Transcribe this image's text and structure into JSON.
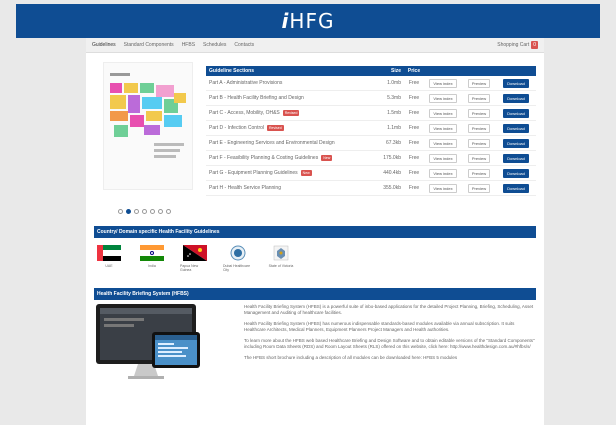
{
  "header": {
    "logo_prefix": "i",
    "logo_text": "HFG"
  },
  "nav": {
    "items": [
      "Guidelines",
      "Standard Components",
      "HFBS",
      "Schedules",
      "Contacts"
    ],
    "cart_label": "Shopping Cart",
    "cart_count": "0"
  },
  "guidelines": {
    "columns": [
      "Guideline Sections",
      "Size",
      "Price"
    ],
    "rows": [
      {
        "title": "Part A - Administrative Provisions",
        "size": "1.0mb",
        "price": "Free",
        "tag": ""
      },
      {
        "title": "Part B - Health Facility Briefing and Design",
        "size": "5.3mb",
        "price": "Free",
        "tag": ""
      },
      {
        "title": "Part C - Access, Mobility, OH&S",
        "size": "1.5mb",
        "price": "Free",
        "tag": "Revised"
      },
      {
        "title": "Part D - Infection Control",
        "size": "1.1mb",
        "price": "Free",
        "tag": "Revised"
      },
      {
        "title": "Part E - Engineering Services and Environmental Design",
        "size": "67.3kb",
        "price": "Free",
        "tag": ""
      },
      {
        "title": "Part F - Feasibility Planning & Costing Guidelines",
        "size": "175.0kb",
        "price": "Free",
        "tag": "New"
      },
      {
        "title": "Part G - Equipment Planning Guidelines",
        "size": "440.4kb",
        "price": "Free",
        "tag": "New"
      },
      {
        "title": "Part H - Health Service Planning",
        "size": "355.0kb",
        "price": "Free",
        "tag": ""
      }
    ],
    "view_index_label": "View index",
    "preview_label": "Preview",
    "download_label": "Download"
  },
  "country_section": {
    "title": "Country/ Domain specific Health Facility Guidelines",
    "flags": [
      {
        "label": "UAE",
        "icon": "uae-flag-icon"
      },
      {
        "label": "India",
        "icon": "india-flag-icon"
      },
      {
        "label": "Papua New Guinea",
        "icon": "png-flag-icon"
      },
      {
        "label": "Dubai Healthcare City",
        "icon": "dhcc-emblem-icon"
      },
      {
        "label": "State of Victoria",
        "icon": "victoria-emblem-icon"
      }
    ]
  },
  "hfbs_section": {
    "title": "Health Facility Briefing System (HFBS)",
    "paragraphs": [
      "Health Facility Briefing System (HFBS) is a powerful suite of inbo-based applications for the detailed Project Planning, Briefing, Scheduling, Asset Management and Auditing of healthcare facilities.",
      "Health Facility Briefing System (HFBS) has numerous indispensable standards-based modules available via annual subscription. It suits Healthcare Architects, Medical Planners, Equipment Planners Project Managers and Health authorities.",
      "To learn more about the HFBS web based Healthcare Briefing and Design Software and to obtain editable versions of the \"Standard Components\" including Room Data Sheets (RDS) and Room Layout Sheets (RLS) offered on this website, click here: http://www.healthdesign.com.au/#hfbs/s/",
      "The HFBS short brochure including a description of all modules can be downloaded here: HFBS 5 modules"
    ]
  },
  "colors": {
    "brand": "#0f4d93",
    "badge": "#d9534f"
  }
}
